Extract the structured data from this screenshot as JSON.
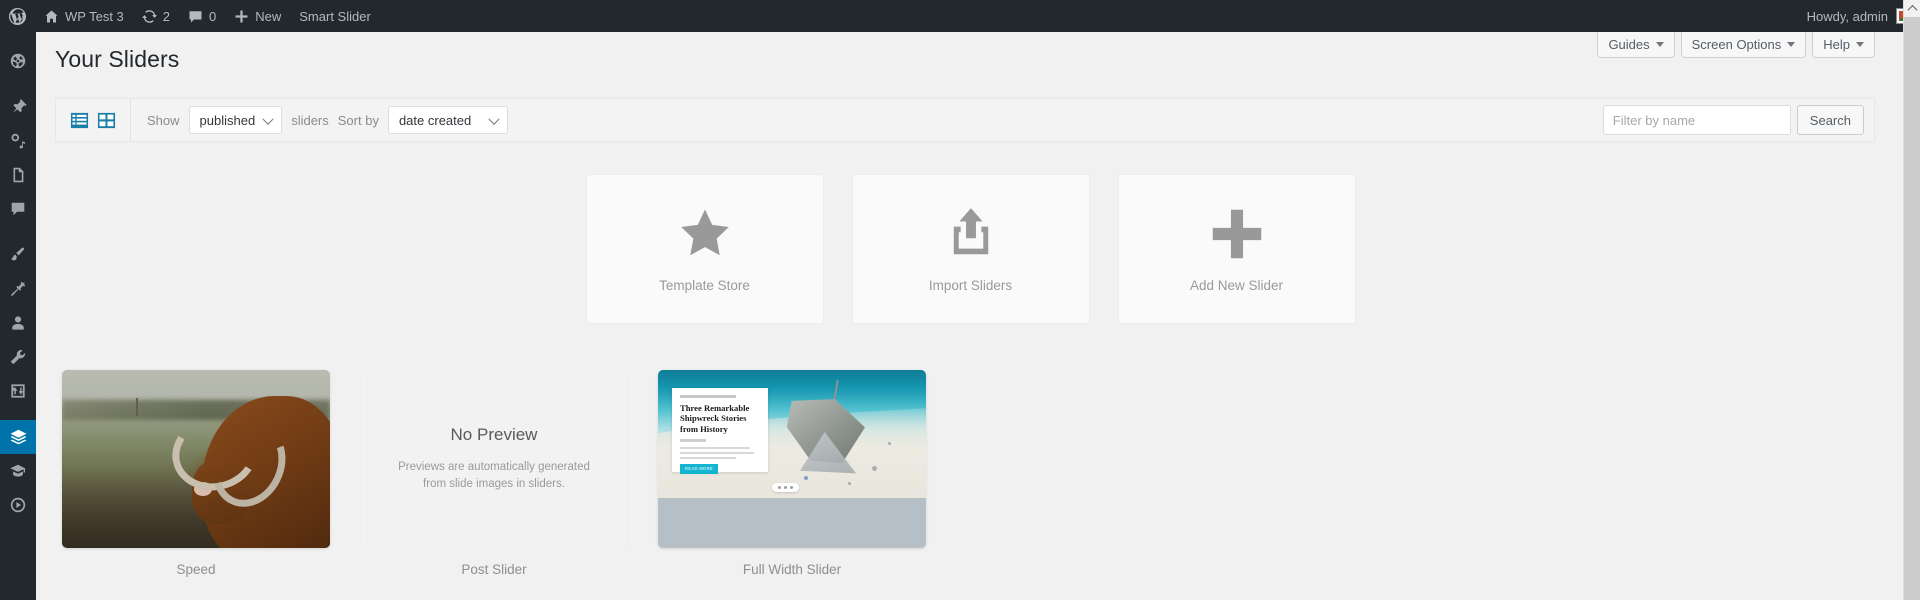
{
  "adminbar": {
    "logo_icon": "wordpress-icon",
    "site": {
      "icon": "home-icon",
      "label": "WP Test 3"
    },
    "updates": {
      "icon": "updates-icon",
      "count": "2"
    },
    "comments": {
      "icon": "comment-icon",
      "count": "0"
    },
    "new": {
      "icon": "plus-icon",
      "label": "New"
    },
    "plugin": {
      "label": "Smart Slider"
    },
    "howdy": "Howdy, admin"
  },
  "sidebar": {
    "items": [
      {
        "name": "dashboard",
        "icon": "dashboard-icon",
        "active": false
      },
      {
        "name": "posts",
        "icon": "pin-icon",
        "active": false
      },
      {
        "name": "media",
        "icon": "media-icon",
        "active": false
      },
      {
        "name": "pages",
        "icon": "pages-icon",
        "active": false
      },
      {
        "name": "comments",
        "icon": "comment-icon",
        "active": false
      },
      {
        "name": "appearance",
        "icon": "paintbrush-icon",
        "active": false
      },
      {
        "name": "plugins",
        "icon": "plug-icon",
        "active": false
      },
      {
        "name": "users",
        "icon": "user-icon",
        "active": false
      },
      {
        "name": "tools",
        "icon": "wrench-icon",
        "active": false
      },
      {
        "name": "settings",
        "icon": "settings-sliders-icon",
        "active": false
      },
      {
        "name": "smart-slider",
        "icon": "layers-icon",
        "active": true
      },
      {
        "name": "learning",
        "icon": "graduation-cap-icon",
        "active": false
      },
      {
        "name": "media-player",
        "icon": "play-circle-icon",
        "active": false
      }
    ]
  },
  "header": {
    "title": "Your Sliders",
    "buttons": [
      {
        "label": "Guides",
        "icon": "chevron-down-icon"
      },
      {
        "label": "Screen Options",
        "icon": "chevron-down-icon"
      },
      {
        "label": "Help",
        "icon": "chevron-down-icon"
      }
    ]
  },
  "filterbar": {
    "views": [
      {
        "name": "list-view",
        "icon": "list-view-icon"
      },
      {
        "name": "grid-view",
        "icon": "grid-view-icon"
      }
    ],
    "show_label": "Show",
    "show_value": "published",
    "sliders_label": "sliders",
    "sortby_label": "Sort by",
    "sortby_value": "date created",
    "search_placeholder": "Filter by name",
    "search_value": "",
    "search_button": "Search"
  },
  "action_cards": [
    {
      "icon": "star-icon",
      "label": "Template Store"
    },
    {
      "icon": "upload-icon",
      "label": "Import Sliders"
    },
    {
      "icon": "plus-icon",
      "label": "Add New Slider"
    }
  ],
  "sliders": [
    {
      "name": "Speed",
      "preview": "image"
    },
    {
      "name": "Post Slider",
      "preview": "none",
      "no_preview_title": "No Preview",
      "no_preview_text": "Previews are automatically generated from slide images in sliders."
    },
    {
      "name": "Full Width Slider",
      "preview": "image",
      "slide_title": "Three Remarkable Shipwreck Stories from History",
      "slide_button": "READ MORE"
    }
  ],
  "colors": {
    "admin_bar": "#23282d",
    "sidebar_active": "#0073aa",
    "accent_blue": "#1a7fa8",
    "page_bg": "#f1f1f1",
    "slide_button": "#14b5d0"
  },
  "scrollbar": {
    "up_icon": "chevron-up-icon"
  }
}
